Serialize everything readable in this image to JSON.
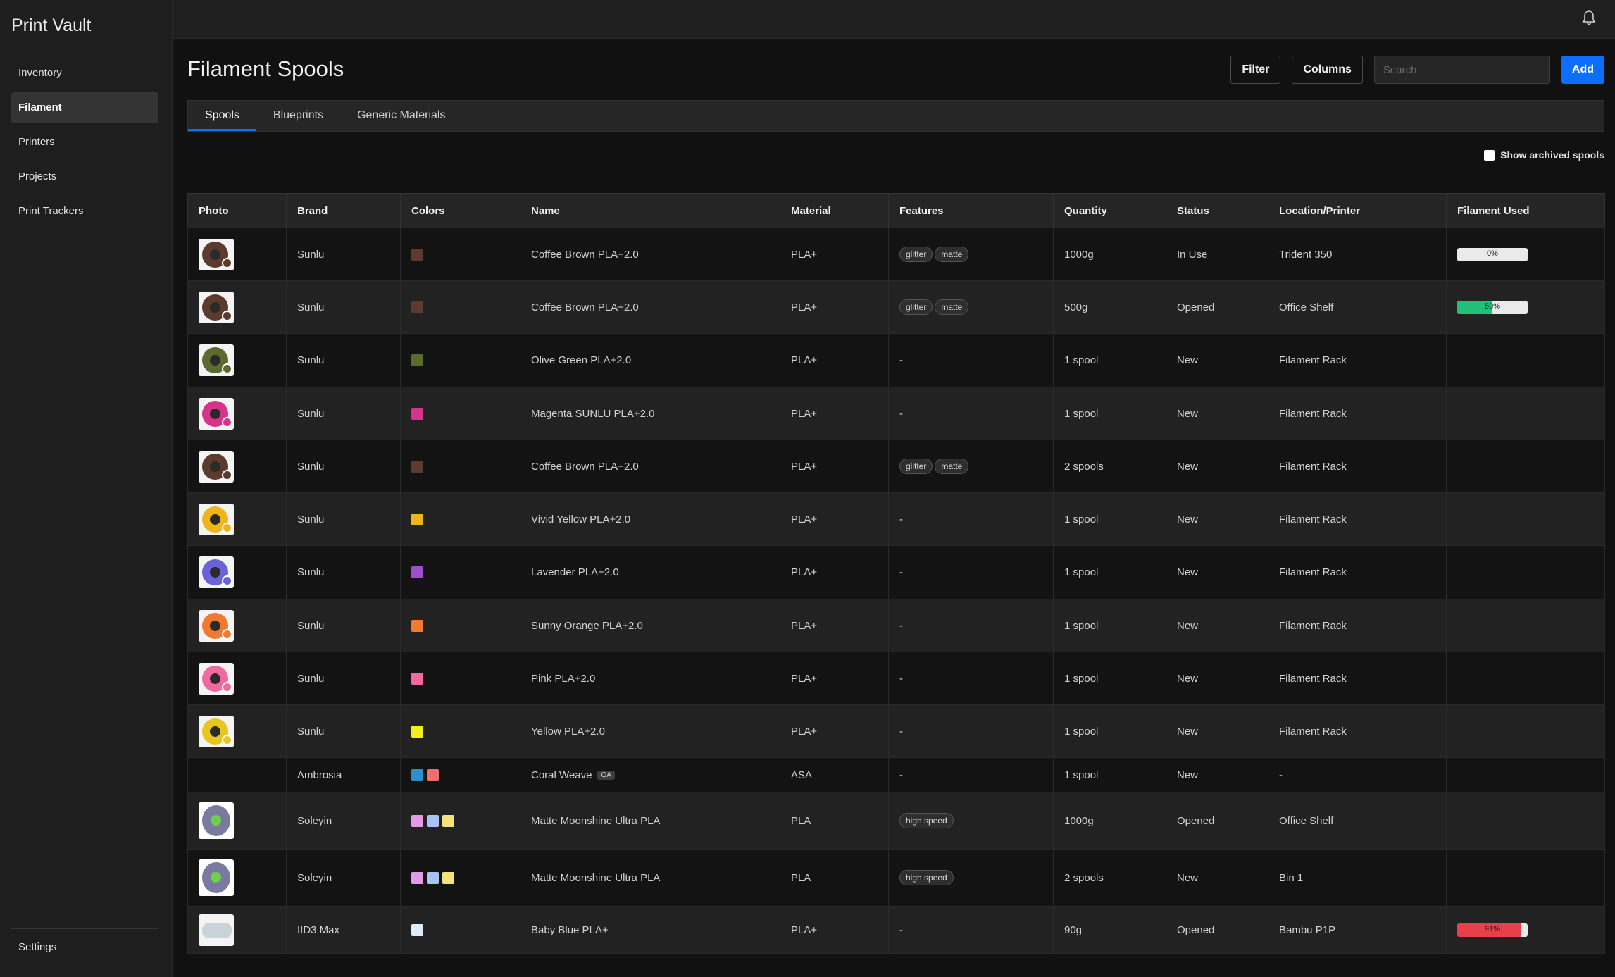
{
  "app": {
    "title": "Print Vault"
  },
  "sidebar": {
    "items": [
      {
        "label": "Inventory",
        "active": false
      },
      {
        "label": "Filament",
        "active": true
      },
      {
        "label": "Printers",
        "active": false
      },
      {
        "label": "Projects",
        "active": false
      },
      {
        "label": "Print Trackers",
        "active": false
      }
    ],
    "settings_label": "Settings"
  },
  "header": {
    "bell_icon": "bell-icon"
  },
  "page": {
    "title": "Filament Spools"
  },
  "toolbar": {
    "filter_label": "Filter",
    "columns_label": "Columns",
    "search_placeholder": "Search",
    "add_label": "Add"
  },
  "tabs": [
    {
      "label": "Spools",
      "active": true
    },
    {
      "label": "Blueprints",
      "active": false
    },
    {
      "label": "Generic Materials",
      "active": false
    }
  ],
  "archived_label": "Show archived spools",
  "table": {
    "columns": [
      "Photo",
      "Brand",
      "Colors",
      "Name",
      "Material",
      "Features",
      "Quantity",
      "Status",
      "Location/Printer",
      "Filament Used"
    ],
    "rows": [
      {
        "brand": "Sunlu",
        "colors": [
          "#5c3a2e"
        ],
        "name": "Coffee Brown PLA+2.0",
        "qa": "",
        "material": "PLA+",
        "features": [
          "glitter",
          "matte"
        ],
        "quantity": "1000g",
        "status": "In Use",
        "location": "Trident 350",
        "used": "0%",
        "used_pct": 0,
        "used_color": "#e0e0e0",
        "photo": "spool",
        "spool_color": "#5c3a2e"
      },
      {
        "brand": "Sunlu",
        "colors": [
          "#5c3a2e"
        ],
        "name": "Coffee Brown PLA+2.0",
        "qa": "",
        "material": "PLA+",
        "features": [
          "glitter",
          "matte"
        ],
        "quantity": "500g",
        "status": "Opened",
        "location": "Office Shelf",
        "used": "50%",
        "used_pct": 50,
        "used_color": "#20c07a",
        "photo": "spool",
        "spool_color": "#5c3a2e"
      },
      {
        "brand": "Sunlu",
        "colors": [
          "#5b6b2e"
        ],
        "name": "Olive Green PLA+2.0",
        "qa": "",
        "material": "PLA+",
        "features": [],
        "features_empty": "-",
        "quantity": "1 spool",
        "status": "New",
        "location": "Filament Rack",
        "used": "",
        "photo": "spool",
        "spool_color": "#5b6b2e"
      },
      {
        "brand": "Sunlu",
        "colors": [
          "#d6338a"
        ],
        "name": "Magenta SUNLU PLA+2.0",
        "qa": "",
        "material": "PLA+",
        "features": [],
        "features_empty": "-",
        "quantity": "1 spool",
        "status": "New",
        "location": "Filament Rack",
        "used": "",
        "photo": "spool",
        "spool_color": "#d6338a"
      },
      {
        "brand": "Sunlu",
        "colors": [
          "#5c3a2e"
        ],
        "name": "Coffee Brown PLA+2.0",
        "qa": "",
        "material": "PLA+",
        "features": [
          "glitter",
          "matte"
        ],
        "quantity": "2 spools",
        "status": "New",
        "location": "Filament Rack",
        "used": "",
        "photo": "spool",
        "spool_color": "#5c3a2e"
      },
      {
        "brand": "Sunlu",
        "colors": [
          "#f0b51c"
        ],
        "name": "Vivid Yellow PLA+2.0",
        "qa": "",
        "material": "PLA+",
        "features": [],
        "features_empty": "-",
        "quantity": "1 spool",
        "status": "New",
        "location": "Filament Rack",
        "used": "",
        "photo": "spool",
        "spool_color": "#f0b51c"
      },
      {
        "brand": "Sunlu",
        "colors": [
          "#9b4fd0"
        ],
        "name": "Lavender PLA+2.0",
        "qa": "",
        "material": "PLA+",
        "features": [],
        "features_empty": "-",
        "quantity": "1 spool",
        "status": "New",
        "location": "Filament Rack",
        "used": "",
        "photo": "spool",
        "spool_color": "#6a63d8"
      },
      {
        "brand": "Sunlu",
        "colors": [
          "#f07a30"
        ],
        "name": "Sunny Orange PLA+2.0",
        "qa": "",
        "material": "PLA+",
        "features": [],
        "features_empty": "-",
        "quantity": "1 spool",
        "status": "New",
        "location": "Filament Rack",
        "used": "",
        "photo": "spool",
        "spool_color": "#f07a30"
      },
      {
        "brand": "Sunlu",
        "colors": [
          "#f06aa2"
        ],
        "name": "Pink PLA+2.0",
        "qa": "",
        "material": "PLA+",
        "features": [],
        "features_empty": "-",
        "quantity": "1 spool",
        "status": "New",
        "location": "Filament Rack",
        "used": "",
        "photo": "spool",
        "spool_color": "#f06aa2"
      },
      {
        "brand": "Sunlu",
        "colors": [
          "#f4ee1a"
        ],
        "name": "Yellow PLA+2.0",
        "qa": "",
        "material": "PLA+",
        "features": [],
        "features_empty": "-",
        "quantity": "1 spool",
        "status": "New",
        "location": "Filament Rack",
        "used": "",
        "photo": "spool",
        "spool_color": "#e8c620"
      },
      {
        "brand": "Ambrosia",
        "colors": [
          "#2f8fc8",
          "#f07070"
        ],
        "name": "Coral Weave",
        "qa": "QA",
        "material": "ASA",
        "features": [],
        "features_empty": "-",
        "quantity": "1 spool",
        "status": "New",
        "location": "-",
        "used": "",
        "photo": "none"
      },
      {
        "brand": "Soleyin",
        "colors": [
          "#e59ae8",
          "#a8c4f5",
          "#f6e27a"
        ],
        "name": "Matte Moonshine Ultra PLA",
        "qa": "",
        "material": "PLA",
        "features": [
          "high speed"
        ],
        "quantity": "1000g",
        "status": "Opened",
        "location": "Office Shelf",
        "used": "",
        "photo": "tall"
      },
      {
        "brand": "Soleyin",
        "colors": [
          "#e59ae8",
          "#a8c4f5",
          "#f6e27a"
        ],
        "name": "Matte Moonshine Ultra PLA",
        "qa": "",
        "material": "PLA",
        "features": [
          "high speed"
        ],
        "quantity": "2 spools",
        "status": "New",
        "location": "Bin 1",
        "used": "",
        "photo": "tall"
      },
      {
        "brand": "IID3 Max",
        "colors": [
          "#dcecf8"
        ],
        "name": "Baby Blue PLA+",
        "qa": "",
        "material": "PLA+",
        "features": [],
        "features_empty": "-",
        "quantity": "90g",
        "status": "Opened",
        "location": "Bambu P1P",
        "used": "91%",
        "used_pct": 91,
        "used_color": "#e8404a",
        "photo": "baby"
      }
    ]
  }
}
